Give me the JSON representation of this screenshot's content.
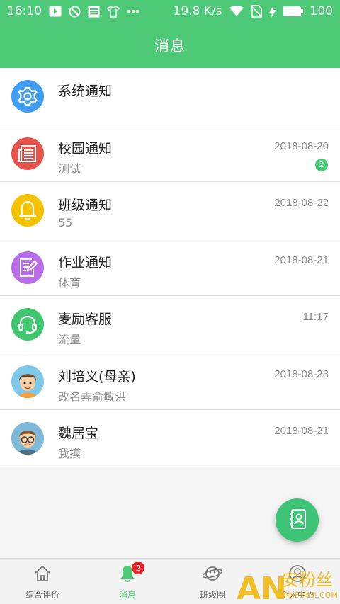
{
  "status_bar": {
    "time": "16:10",
    "speed": "19.8 K/s",
    "battery": "100",
    "icons": [
      "video-play-icon",
      "blocked-icon",
      "news-icon",
      "shirt-icon",
      "more-icon",
      "wifi-icon",
      "sim-off-icon",
      "charging-icon",
      "battery-icon"
    ]
  },
  "header": {
    "title": "消息"
  },
  "messages": [
    {
      "title": "系统通知",
      "subtitle": "",
      "time": "",
      "badge": "",
      "icon": "gear-icon",
      "color": "#3e9ef3"
    },
    {
      "title": "校园通知",
      "subtitle": "测试",
      "time": "2018-08-20",
      "badge": "2",
      "icon": "newspaper-icon",
      "color": "#e5534b"
    },
    {
      "title": "班级通知",
      "subtitle": "55",
      "time": "2018-08-22",
      "badge": "",
      "icon": "bell-icon",
      "color": "#f5c200"
    },
    {
      "title": "作业通知",
      "subtitle": "体育",
      "time": "2018-08-21",
      "badge": "",
      "icon": "edit-note-icon",
      "color": "#b86ee8"
    },
    {
      "title": "麦励客服",
      "subtitle": "流量",
      "time": "11:17",
      "badge": "",
      "icon": "headset-icon",
      "color": "#3fc66f"
    },
    {
      "title": "刘培义(母亲)",
      "subtitle": "改名弄俞敏洪",
      "time": "2018-08-23",
      "badge": "",
      "icon": "boy-avatar-icon",
      "color": "#7fc9e8"
    },
    {
      "title": "魏居宝",
      "subtitle": "我摸",
      "time": "2018-08-21",
      "badge": "",
      "icon": "glasses-avatar-icon",
      "color": "#7fb9d8"
    }
  ],
  "fab": {
    "icon": "contacts-icon",
    "color": "#3dc476"
  },
  "bottom_nav": {
    "items": [
      {
        "label": "综合评价",
        "icon": "home-icon",
        "active": false
      },
      {
        "label": "消息",
        "icon": "bell-icon",
        "active": true,
        "badge": "2"
      },
      {
        "label": "班级圈",
        "icon": "planet-icon",
        "active": false
      },
      {
        "label": "个人中心",
        "icon": "user-icon",
        "active": false
      }
    ]
  },
  "watermark": {
    "text": "ANFENSI.COM",
    "brand": "安粉丝"
  },
  "colors": {
    "accent": "#4ec977",
    "badge_red": "#e8232b"
  }
}
